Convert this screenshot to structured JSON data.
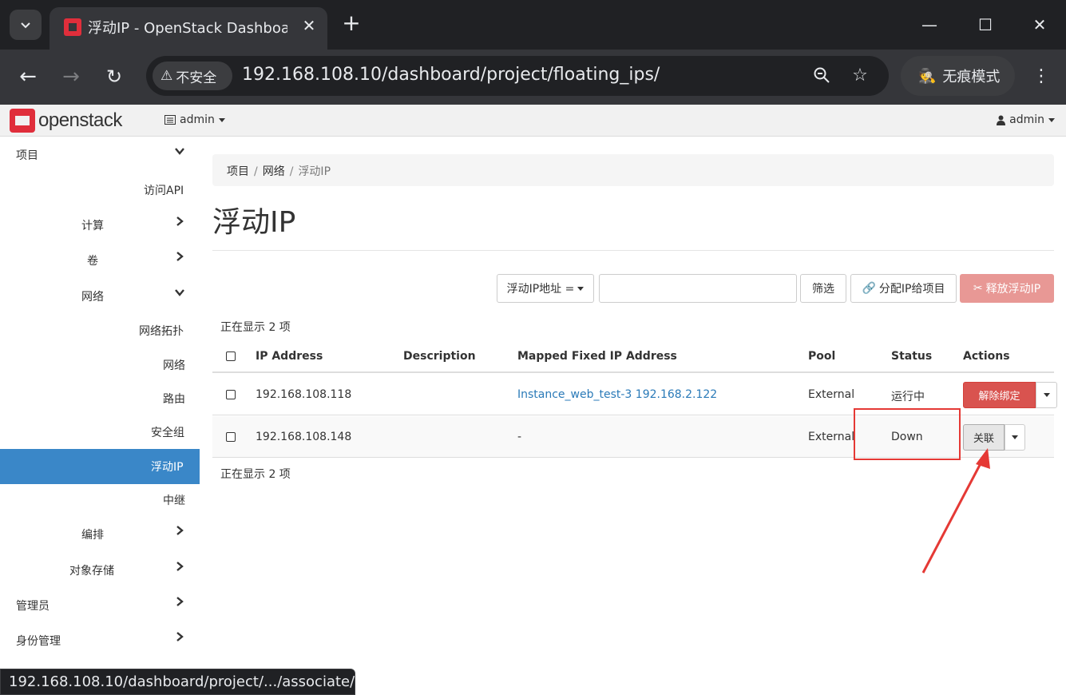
{
  "browser": {
    "tab_title": "浮动IP - OpenStack Dashboard",
    "security_label": "不安全",
    "url": "192.168.108.10/dashboard/project/floating_ips/",
    "incognito_label": "无痕模式",
    "status_url": "192.168.108.10/dashboard/project/.../associate/..."
  },
  "topnav": {
    "logo_text": "openstack",
    "project": "admin",
    "user": "admin"
  },
  "sidebar": {
    "items": [
      {
        "label": "项目"
      },
      {
        "label": "访问API"
      },
      {
        "label": "计算"
      },
      {
        "label": "卷"
      },
      {
        "label": "网络"
      },
      {
        "label": "网络拓扑"
      },
      {
        "label": "网络"
      },
      {
        "label": "路由"
      },
      {
        "label": "安全组"
      },
      {
        "label": "浮动IP"
      },
      {
        "label": "中继"
      },
      {
        "label": "编排"
      },
      {
        "label": "对象存储"
      },
      {
        "label": "管理员"
      },
      {
        "label": "身份管理"
      }
    ]
  },
  "breadcrumb": [
    "项目",
    "网络",
    "浮动IP"
  ],
  "page_title": "浮动IP",
  "filter": {
    "field_label": "浮动IP地址 =",
    "filter_button": "筛选",
    "allocate_button": "分配IP给项目",
    "release_button": "释放浮动IP"
  },
  "table": {
    "count_text": "正在显示 2 项",
    "columns": [
      "IP Address",
      "Description",
      "Mapped Fixed IP Address",
      "Pool",
      "Status",
      "Actions"
    ],
    "rows": [
      {
        "ip": "192.168.108.118",
        "description": "",
        "mapped": "Instance_web_test-3 192.168.2.122",
        "pool": "External",
        "status": "运行中",
        "action": "解除绑定"
      },
      {
        "ip": "192.168.108.148",
        "description": "",
        "mapped": "-",
        "pool": "External",
        "status": "Down",
        "action": "关联"
      }
    ]
  },
  "colors": {
    "accent_active": "#3a87c8",
    "danger": "#d9534f",
    "highlight": "#e53935"
  }
}
